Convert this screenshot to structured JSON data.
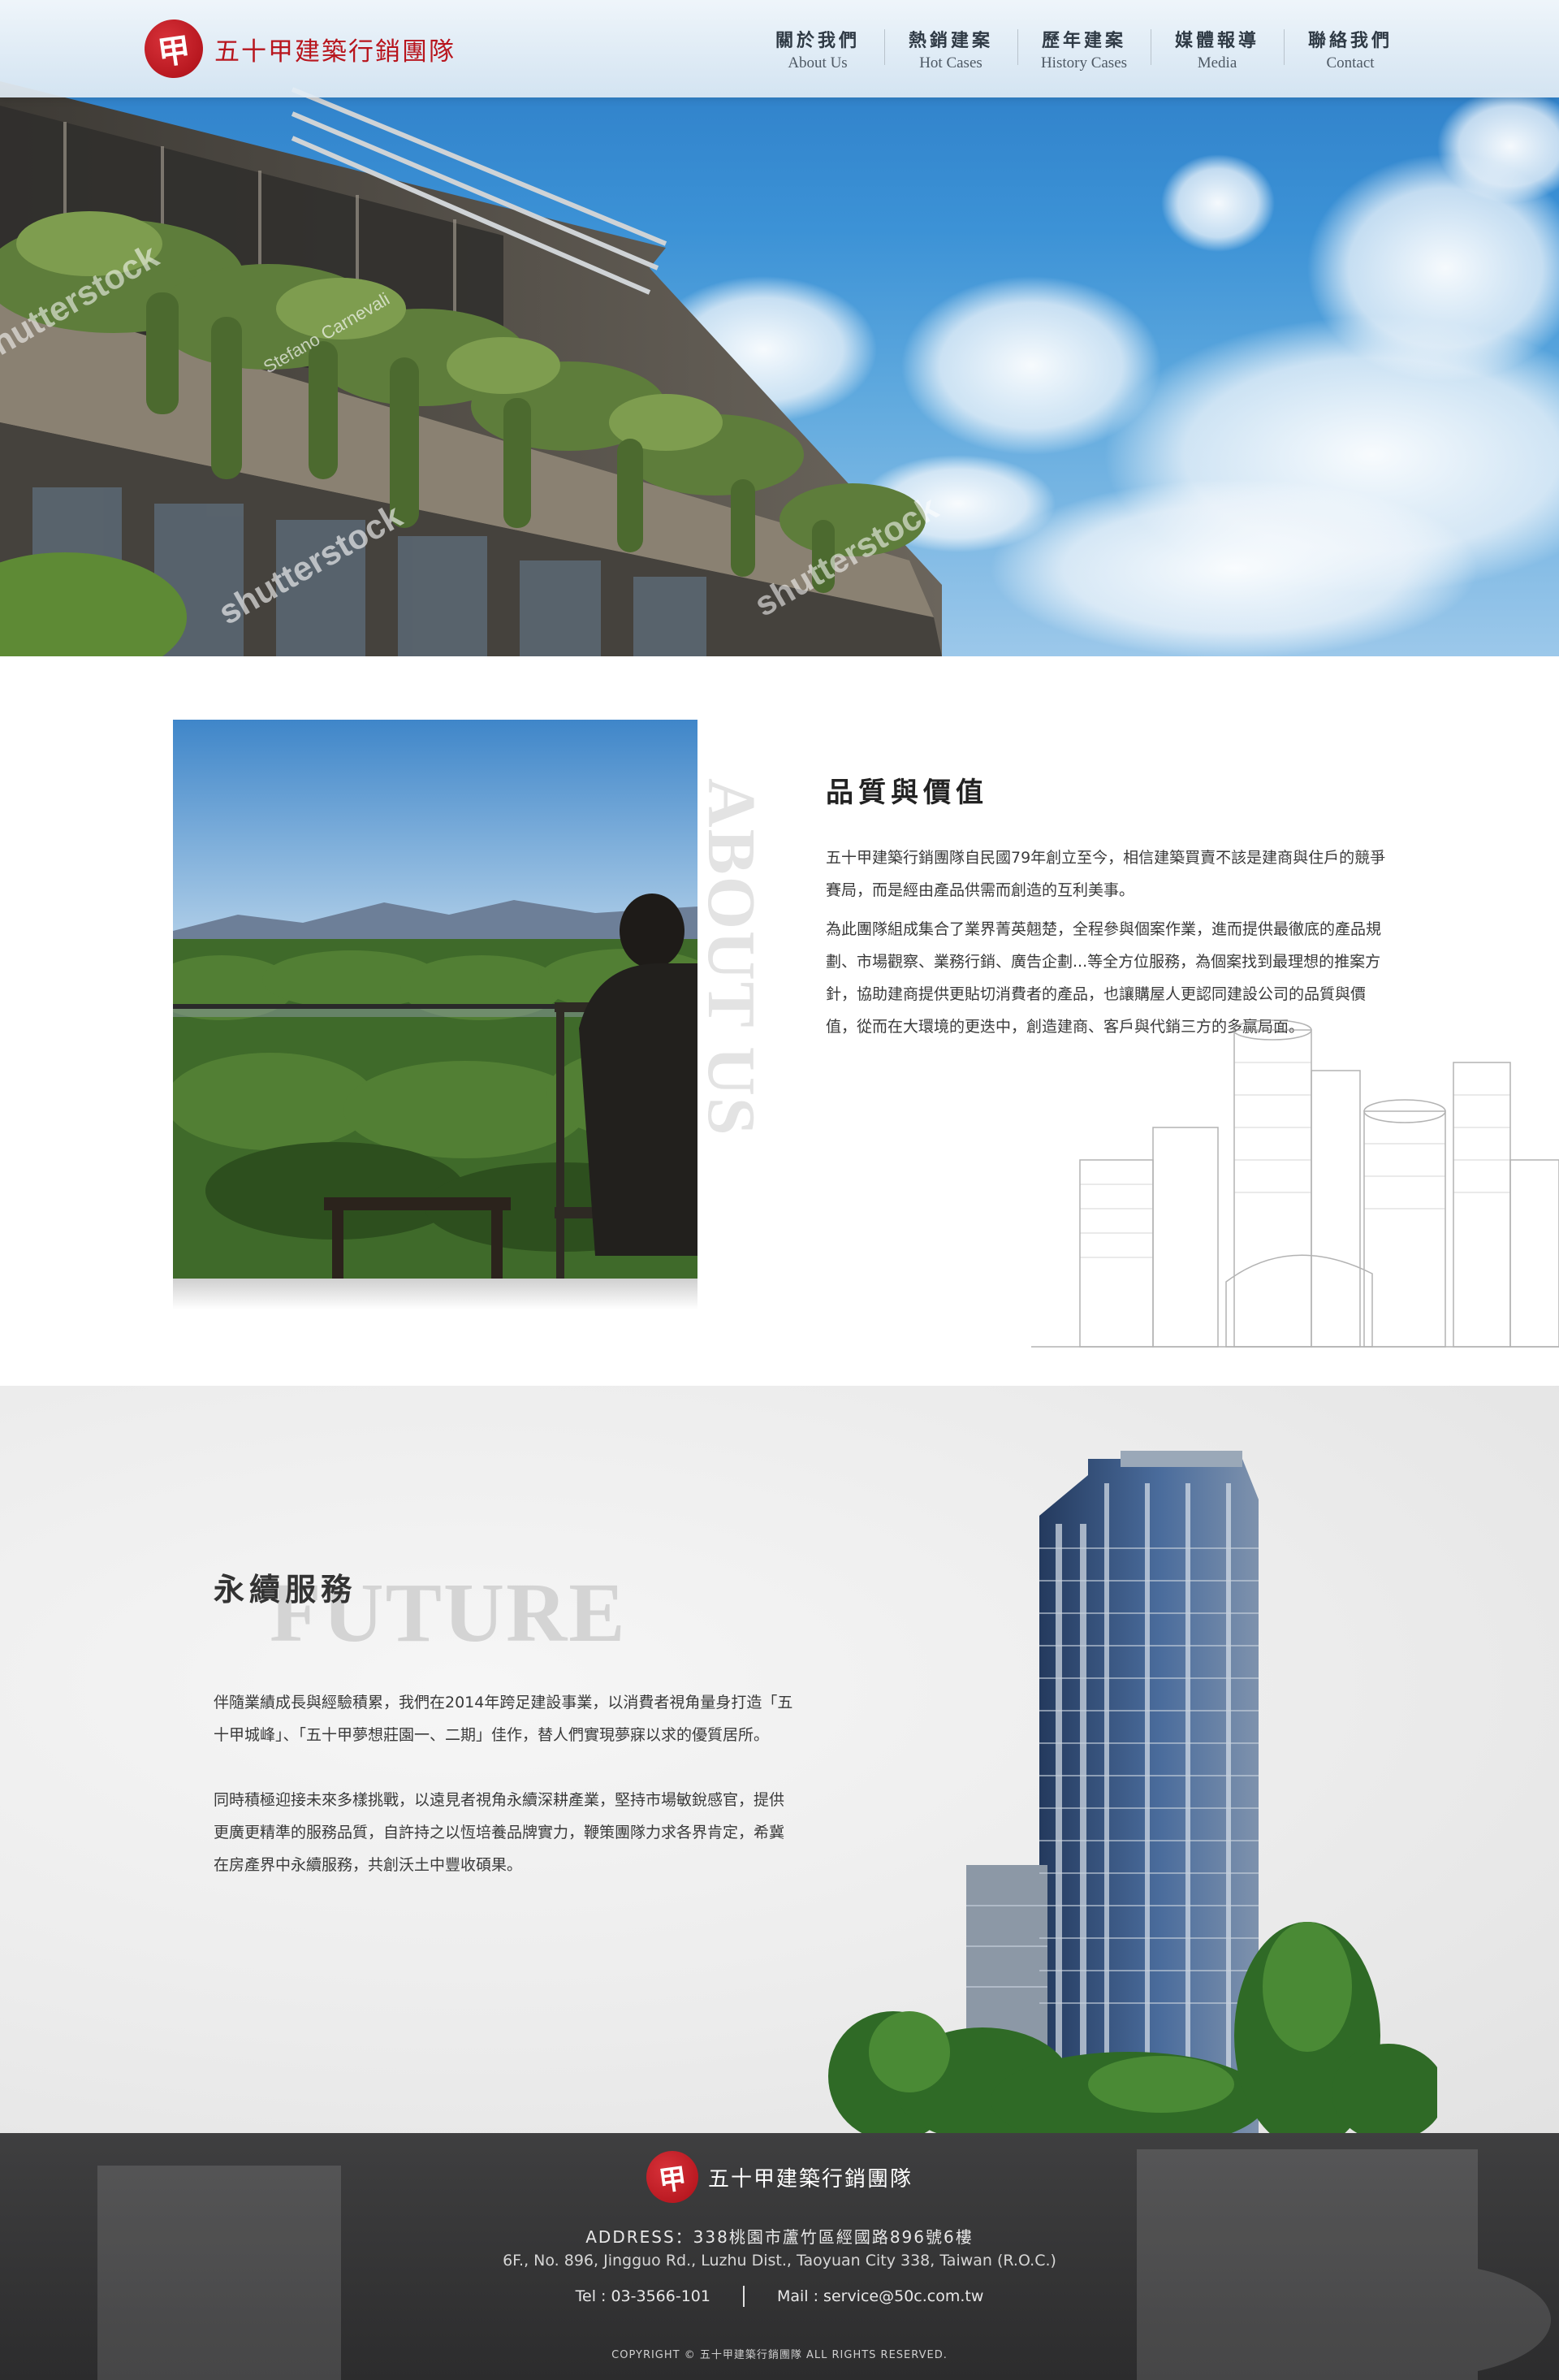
{
  "brand": {
    "name": "五十甲建築行銷團隊",
    "seal_char": "甲"
  },
  "nav": [
    {
      "zh": "關於我們",
      "en": "About Us"
    },
    {
      "zh": "熱銷建案",
      "en": "Hot Cases"
    },
    {
      "zh": "歷年建案",
      "en": "History Cases"
    },
    {
      "zh": "媒體報導",
      "en": "Media"
    },
    {
      "zh": "聯絡我們",
      "en": "Contact"
    }
  ],
  "hero": {
    "watermark": "shutterstock",
    "credit": "Stefano Carnevali"
  },
  "about": {
    "vertical_word": "ABOUT US",
    "title": "品質與價值",
    "paragraphs": [
      "五十甲建築行銷團隊自民國79年創立至今，相信建築買賣不該是建商與住戶的競爭賽局，而是經由產品供需而創造的互利美事。",
      "為此團隊組成集合了業界菁英翹楚，全程參與個案作業，進而提供最徹底的產品規劃、市場觀察、業務行銷、廣告企劃...等全方位服務，為個案找到最理想的推案方針，協助建商提供更貼切消費者的產品，也讓購屋人更認同建設公司的品質與價值，從而在大環境的更迭中，創造建商、客戶與代銷三方的多贏局面。"
    ]
  },
  "future": {
    "bg_word": "FUTURE",
    "title": "永續服務",
    "paragraphs": [
      "伴隨業績成長與經驗積累，我們在2014年跨足建設事業，以消費者視角量身打造「五十甲城峰」、「五十甲夢想莊園一、二期」佳作，替人們實現夢寐以求的優質居所。",
      "同時積極迎接未來多樣挑戰，以遠見者視角永續深耕產業，堅持市場敏銳感官，提供更廣更精準的服務品質，自許持之以恆培養品牌實力，鞭策團隊力求各界肯定，希冀在房產界中永續服務，共創沃土中豐收碩果。"
    ]
  },
  "footer": {
    "address_label": "ADDRESS：",
    "address_zh": "338桃園市蘆竹區經國路896號6樓",
    "address_en": "6F., No. 896, Jingguo Rd., Luzhu Dist., Taoyuan City 338, Taiwan (R.O.C.)",
    "tel": "Tel : 03-3566-101",
    "mail": "Mail : service@50c.com.tw",
    "copyright": "COPYRIGHT © 五十甲建築行銷團隊 ALL RIGHTS RESERVED."
  }
}
